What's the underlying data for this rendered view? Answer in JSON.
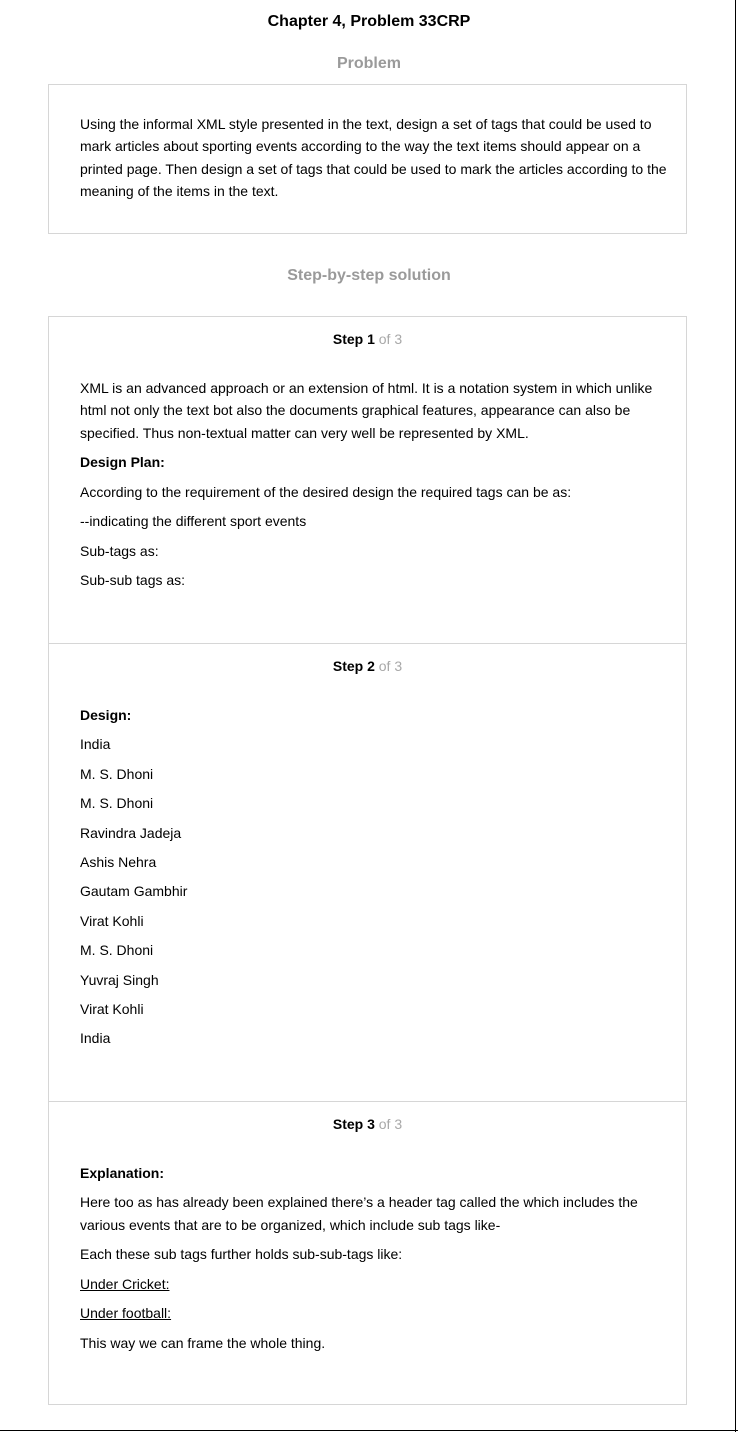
{
  "title": "Chapter 4, Problem 33CRP",
  "problem_heading": "Problem",
  "problem_text": "Using the informal XML style presented in the text, design a set of tags that could be used to mark articles about sporting events according to the way the text items should appear on a printed page. Then design a set of tags that could be used to mark the articles according to the meaning of the items in the text.",
  "solution_heading": "Step-by-step solution",
  "steps": [
    {
      "label": "Step 1",
      "of": "of 3",
      "intro": "XML is an advanced approach or an extension of html. It is a notation system in which unlike html not only the text bot also the documents graphical features, appearance can also be specified. Thus non-textual matter can very well be represented by XML.",
      "subheading": "Design Plan:",
      "lines": [
        "According to the requirement of the desired design the required tags can be as:",
        "--indicating the different sport events",
        "Sub-tags as:",
        "Sub-sub tags as:"
      ]
    },
    {
      "label": "Step 2",
      "of": "of 3",
      "subheading": "Design:",
      "lines": [
        "India",
        "M. S. Dhoni",
        "M. S. Dhoni",
        "Ravindra Jadeja",
        "Ashis Nehra",
        "Gautam Gambhir",
        "Virat Kohli",
        "M. S. Dhoni",
        "Yuvraj Singh",
        "Virat Kohli",
        "India"
      ]
    },
    {
      "label": "Step 3",
      "of": "of 3",
      "subheading": "Explanation:",
      "intro": "Here too as has already been explained there’s a header tag called the which includes the various events that are to be organized, which include sub tags like-",
      "lines": [
        "Each these sub tags further holds sub-sub-tags like:",
        "Under Cricket:",
        "Under football:",
        "This way we can frame the whole thing."
      ]
    }
  ]
}
